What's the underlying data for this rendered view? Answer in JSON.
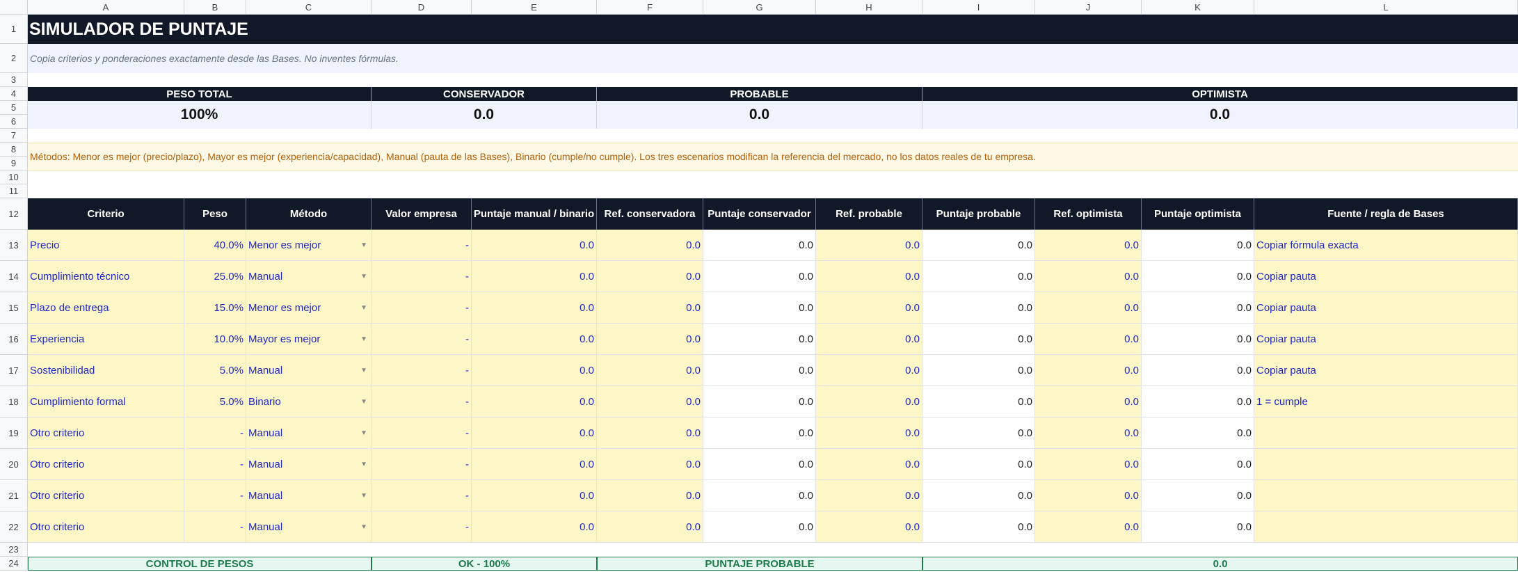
{
  "columns": [
    "A",
    "B",
    "C",
    "D",
    "E",
    "F",
    "G",
    "H",
    "I",
    "J",
    "K",
    "L"
  ],
  "rows": [
    "1",
    "2",
    "3",
    "4",
    "5",
    "6",
    "7",
    "8",
    "9",
    "10",
    "11",
    "12",
    "13",
    "14",
    "15",
    "16",
    "17",
    "18",
    "19",
    "20",
    "21",
    "22",
    "23",
    "24"
  ],
  "title": "SIMULADOR DE PUNTAJE",
  "subtitle": "Copia criterios y ponderaciones exactamente desde las Bases. No inventes fórmulas.",
  "summary": {
    "headers": [
      "PESO TOTAL",
      "CONSERVADOR",
      "PROBABLE",
      "OPTIMISTA"
    ],
    "values": [
      "100%",
      "0.0",
      "0.0",
      "0.0"
    ]
  },
  "note": "Métodos: Menor es mejor (precio/plazo), Mayor es mejor (experiencia/capacidad), Manual (pauta de las Bases), Binario (cumple/no cumple). Los tres escenarios modifican la referencia del mercado, no los datos reales de tu empresa.",
  "table": {
    "headers": [
      "Criterio",
      "Peso",
      "Método",
      "Valor empresa",
      "Puntaje manual / binario",
      "Ref. conservadora",
      "Puntaje conservador",
      "Ref. probable",
      "Puntaje probable",
      "Ref. optimista",
      "Puntaje optimista",
      "Fuente / regla de Bases"
    ],
    "rows": [
      [
        "Precio",
        "40.0%",
        "Menor es mejor",
        "-",
        "0.0",
        "0.0",
        "0.0",
        "0.0",
        "0.0",
        "0.0",
        "0.0",
        "Copiar fórmula exacta"
      ],
      [
        "Cumplimiento técnico",
        "25.0%",
        "Manual",
        "-",
        "0.0",
        "0.0",
        "0.0",
        "0.0",
        "0.0",
        "0.0",
        "0.0",
        "Copiar pauta"
      ],
      [
        "Plazo de entrega",
        "15.0%",
        "Menor es mejor",
        "-",
        "0.0",
        "0.0",
        "0.0",
        "0.0",
        "0.0",
        "0.0",
        "0.0",
        "Copiar pauta"
      ],
      [
        "Experiencia",
        "10.0%",
        "Mayor es mejor",
        "-",
        "0.0",
        "0.0",
        "0.0",
        "0.0",
        "0.0",
        "0.0",
        "0.0",
        "Copiar pauta"
      ],
      [
        "Sostenibilidad",
        "5.0%",
        "Manual",
        "-",
        "0.0",
        "0.0",
        "0.0",
        "0.0",
        "0.0",
        "0.0",
        "0.0",
        "Copiar pauta"
      ],
      [
        "Cumplimiento formal",
        "5.0%",
        "Binario",
        "-",
        "0.0",
        "0.0",
        "0.0",
        "0.0",
        "0.0",
        "0.0",
        "0.0",
        "1 = cumple"
      ],
      [
        "Otro criterio",
        "-",
        "Manual",
        "-",
        "0.0",
        "0.0",
        "0.0",
        "0.0",
        "0.0",
        "0.0",
        "0.0",
        ""
      ],
      [
        "Otro criterio",
        "-",
        "Manual",
        "-",
        "0.0",
        "0.0",
        "0.0",
        "0.0",
        "0.0",
        "0.0",
        "0.0",
        ""
      ],
      [
        "Otro criterio",
        "-",
        "Manual",
        "-",
        "0.0",
        "0.0",
        "0.0",
        "0.0",
        "0.0",
        "0.0",
        "0.0",
        ""
      ],
      [
        "Otro criterio",
        "-",
        "Manual",
        "-",
        "0.0",
        "0.0",
        "0.0",
        "0.0",
        "0.0",
        "0.0",
        "0.0",
        ""
      ]
    ]
  },
  "control": {
    "label1": "CONTROL DE PESOS",
    "value1": "OK - 100%",
    "label2": "PUNTAJE PROBABLE",
    "value2": "0.0"
  },
  "icons": {
    "dropdown": "chevron-down-icon"
  },
  "colors": {
    "dark_header": "#111827",
    "input_fill": "#fdf6c7",
    "input_text": "#1f27c9",
    "note_text": "#b45f06",
    "control_green": "#1e7a4a"
  }
}
